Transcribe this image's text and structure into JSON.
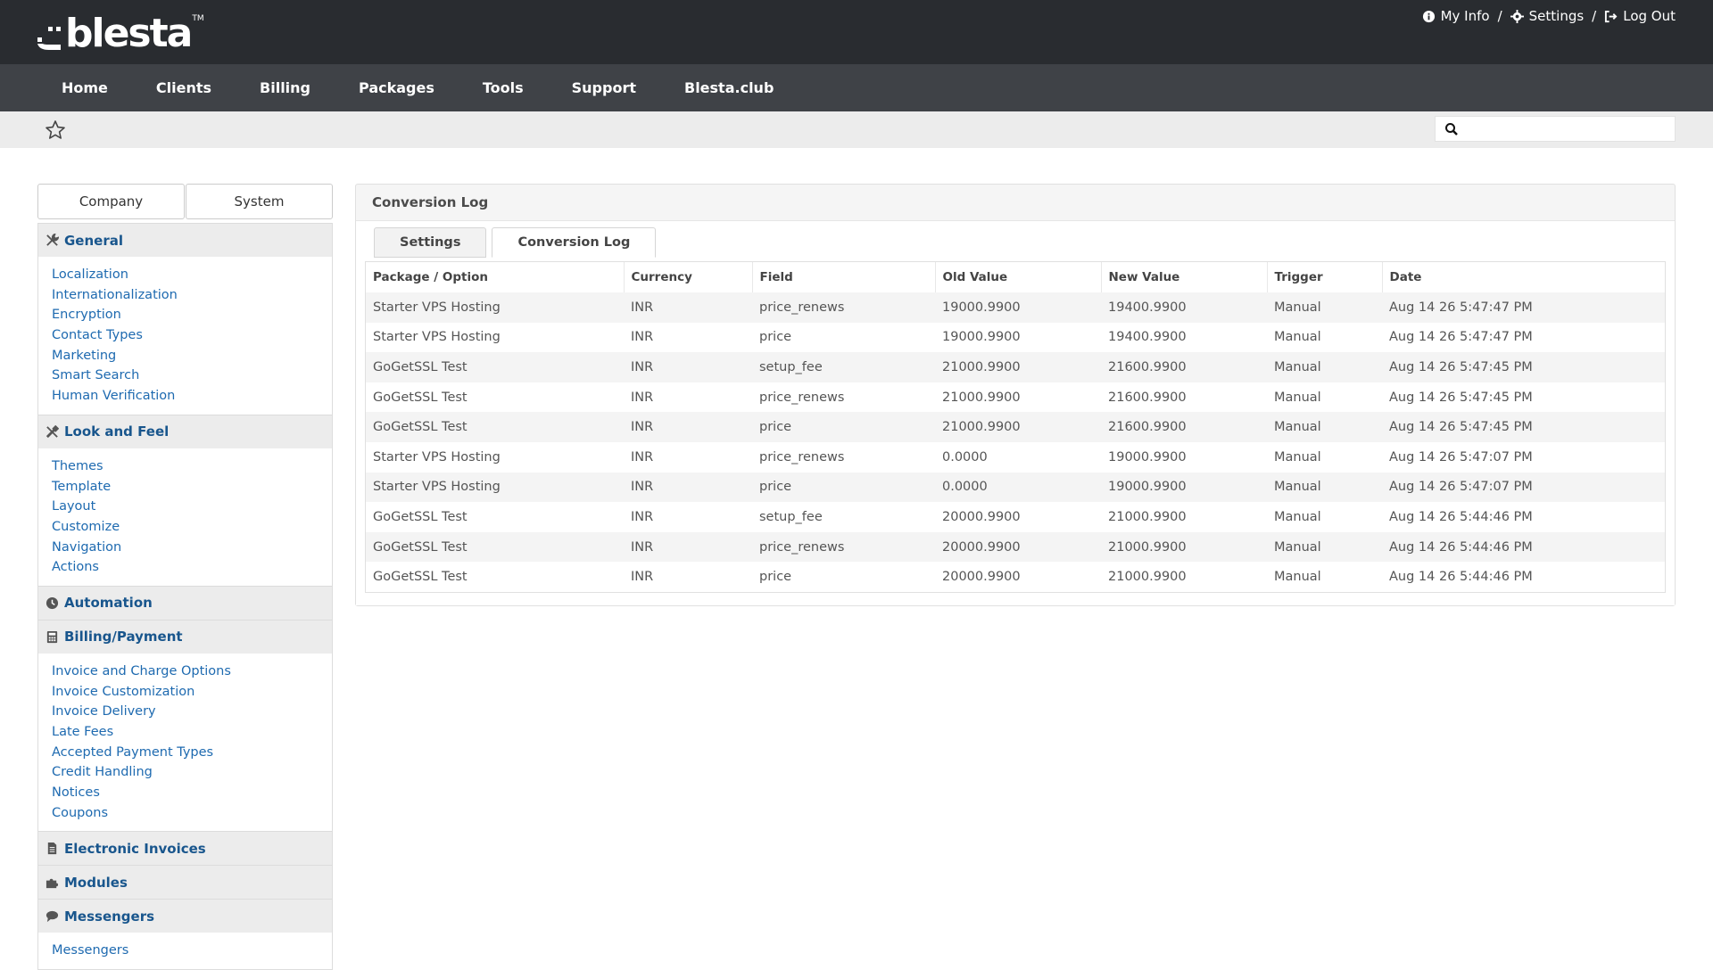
{
  "brand": {
    "name": "blesta",
    "tm": "TM"
  },
  "top_links": {
    "my_info": "My Info",
    "settings": "Settings",
    "log_out": "Log Out",
    "separator": "/"
  },
  "nav": {
    "items": [
      "Home",
      "Clients",
      "Billing",
      "Packages",
      "Tools",
      "Support",
      "Blesta.club"
    ]
  },
  "search": {
    "placeholder": "",
    "value": ""
  },
  "sidebar": {
    "tabs": [
      "Company",
      "System"
    ],
    "sections": [
      {
        "title": "General",
        "icon": "wrench-icon",
        "links": [
          "Localization",
          "Internationalization",
          "Encryption",
          "Contact Types",
          "Marketing",
          "Smart Search",
          "Human Verification"
        ]
      },
      {
        "title": "Look and Feel",
        "icon": "paint-icon",
        "links": [
          "Themes",
          "Template",
          "Layout",
          "Customize",
          "Navigation",
          "Actions"
        ]
      },
      {
        "title": "Automation",
        "icon": "clock-icon",
        "links": []
      },
      {
        "title": "Billing/Payment",
        "icon": "calculator-icon",
        "links": [
          "Invoice and Charge Options",
          "Invoice Customization",
          "Invoice Delivery",
          "Late Fees",
          "Accepted Payment Types",
          "Credit Handling",
          "Notices",
          "Coupons"
        ]
      },
      {
        "title": "Electronic Invoices",
        "icon": "document-icon",
        "links": []
      },
      {
        "title": "Modules",
        "icon": "puzzle-icon",
        "links": []
      },
      {
        "title": "Messengers",
        "icon": "chat-icon",
        "links": [
          "Messengers"
        ]
      }
    ]
  },
  "panel": {
    "title": "Conversion Log",
    "tabs": [
      "Settings",
      "Conversion Log"
    ],
    "active_tab": "Conversion Log",
    "columns": [
      "Package / Option",
      "Currency",
      "Field",
      "Old Value",
      "New Value",
      "Trigger",
      "Date"
    ],
    "rows": [
      [
        "Starter VPS Hosting",
        "INR",
        "price_renews",
        "19000.9900",
        "19400.9900",
        "Manual",
        "Aug 14 26 5:47:47 PM"
      ],
      [
        "Starter VPS Hosting",
        "INR",
        "price",
        "19000.9900",
        "19400.9900",
        "Manual",
        "Aug 14 26 5:47:47 PM"
      ],
      [
        "GoGetSSL Test",
        "INR",
        "setup_fee",
        "21000.9900",
        "21600.9900",
        "Manual",
        "Aug 14 26 5:47:45 PM"
      ],
      [
        "GoGetSSL Test",
        "INR",
        "price_renews",
        "21000.9900",
        "21600.9900",
        "Manual",
        "Aug 14 26 5:47:45 PM"
      ],
      [
        "GoGetSSL Test",
        "INR",
        "price",
        "21000.9900",
        "21600.9900",
        "Manual",
        "Aug 14 26 5:47:45 PM"
      ],
      [
        "Starter VPS Hosting",
        "INR",
        "price_renews",
        "0.0000",
        "19000.9900",
        "Manual",
        "Aug 14 26 5:47:07 PM"
      ],
      [
        "Starter VPS Hosting",
        "INR",
        "price",
        "0.0000",
        "19000.9900",
        "Manual",
        "Aug 14 26 5:47:07 PM"
      ],
      [
        "GoGetSSL Test",
        "INR",
        "setup_fee",
        "20000.9900",
        "21000.9900",
        "Manual",
        "Aug 14 26 5:44:46 PM"
      ],
      [
        "GoGetSSL Test",
        "INR",
        "price_renews",
        "20000.9900",
        "21000.9900",
        "Manual",
        "Aug 14 26 5:44:46 PM"
      ],
      [
        "GoGetSSL Test",
        "INR",
        "price",
        "20000.9900",
        "21000.9900",
        "Manual",
        "Aug 14 26 5:44:46 PM"
      ]
    ]
  }
}
